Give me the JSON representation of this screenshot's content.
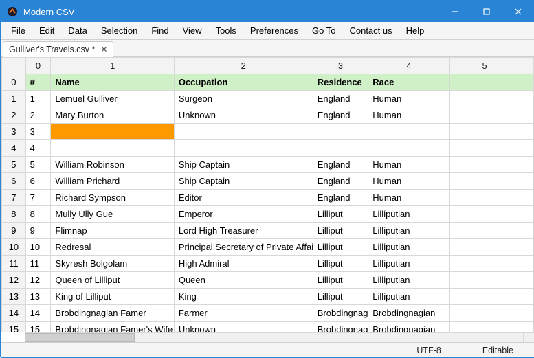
{
  "app": {
    "title": "Modern CSV"
  },
  "window_controls": {
    "min": "minimize",
    "max": "maximize",
    "close": "close"
  },
  "menu": [
    "File",
    "Edit",
    "Data",
    "Selection",
    "Find",
    "View",
    "Tools",
    "Preferences",
    "Go To",
    "Contact us",
    "Help"
  ],
  "tab": {
    "label": "Gulliver's Travels.csv *",
    "close_glyph": "✕"
  },
  "columns": [
    "0",
    "1",
    "2",
    "3",
    "4",
    "5"
  ],
  "header_row": {
    "index": "0",
    "cells": [
      "#",
      "Name",
      "Occupation",
      "Residence",
      "Race",
      ""
    ]
  },
  "rows": [
    {
      "index": "1",
      "cells": [
        "1",
        "Lemuel Gulliver",
        "Surgeon",
        "England",
        "Human",
        ""
      ]
    },
    {
      "index": "2",
      "cells": [
        "2",
        "Mary Burton",
        "Unknown",
        "England",
        "Human",
        ""
      ]
    },
    {
      "index": "3",
      "cells": [
        "3",
        "",
        "",
        "",
        "",
        ""
      ]
    },
    {
      "index": "4",
      "cells": [
        "4",
        "",
        "",
        "",
        "",
        ""
      ]
    },
    {
      "index": "5",
      "cells": [
        "5",
        "William Robinson",
        "Ship Captain",
        "England",
        "Human",
        ""
      ]
    },
    {
      "index": "6",
      "cells": [
        "6",
        "William Prichard",
        "Ship Captain",
        "England",
        "Human",
        ""
      ]
    },
    {
      "index": "7",
      "cells": [
        "7",
        "Richard Sympson",
        "Editor",
        "England",
        "Human",
        ""
      ]
    },
    {
      "index": "8",
      "cells": [
        "8",
        "Mully Ully Gue",
        "Emperor",
        "Lilliput",
        "Lilliputian",
        ""
      ]
    },
    {
      "index": "9",
      "cells": [
        "9",
        "Flimnap",
        "Lord High Treasurer",
        "Lilliput",
        "Lilliputian",
        ""
      ]
    },
    {
      "index": "10",
      "cells": [
        "10",
        "Redresal",
        "Principal Secretary of Private Affairs",
        "Lilliput",
        "Lilliputian",
        ""
      ]
    },
    {
      "index": "11",
      "cells": [
        "11",
        "Skyresh Bolgolam",
        "High Admiral",
        "Lilliput",
        "Lilliputian",
        ""
      ]
    },
    {
      "index": "12",
      "cells": [
        "12",
        "Queen of Lilliput",
        "Queen",
        "Lilliput",
        "Lilliputian",
        ""
      ]
    },
    {
      "index": "13",
      "cells": [
        "13",
        "King of Lilliput",
        "King",
        "Lilliput",
        "Lilliputian",
        ""
      ]
    },
    {
      "index": "14",
      "cells": [
        "14",
        "Brobdingnagian Famer",
        "Farmer",
        "Brobdingnag",
        "Brobdingnagian",
        ""
      ]
    },
    {
      "index": "15",
      "cells": [
        "15",
        "Brobdingnagian Famer's Wife",
        "Unknown",
        "Brobdingnag",
        "Brobdingnagian",
        ""
      ]
    }
  ],
  "active_cell": {
    "row_index": "3",
    "col": 1
  },
  "status": {
    "encoding": "UTF-8",
    "mode": "Editable"
  }
}
